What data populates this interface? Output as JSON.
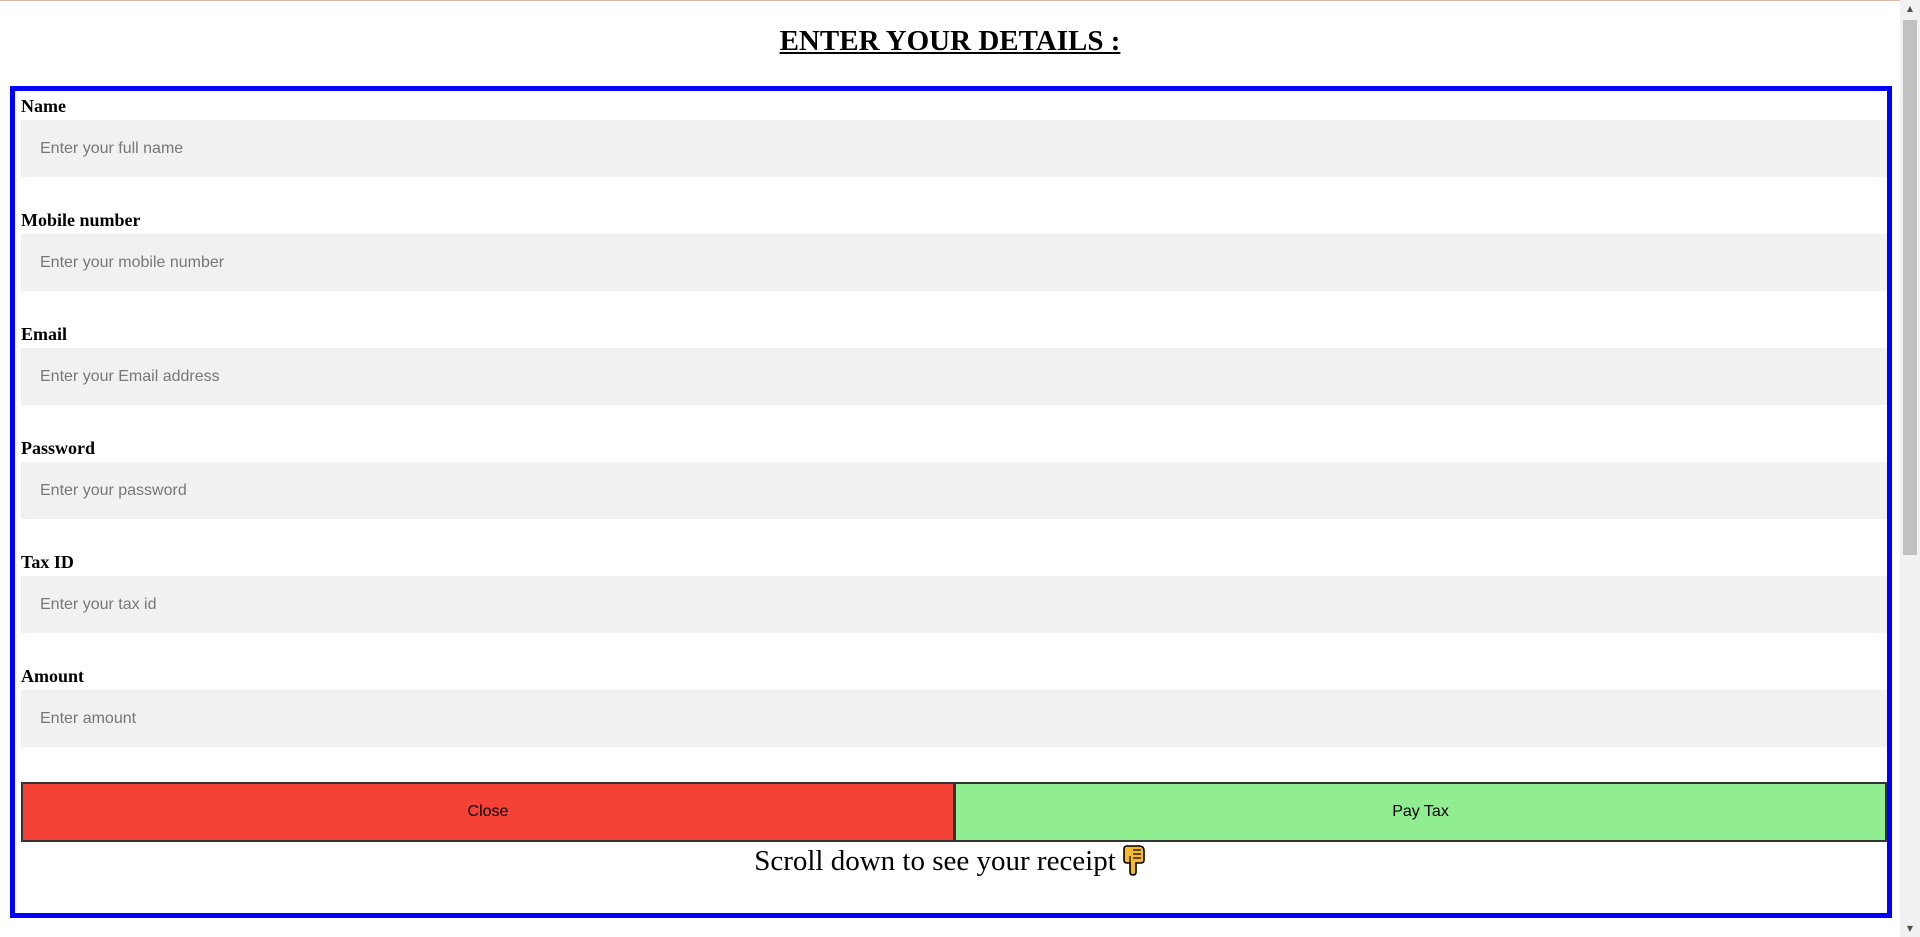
{
  "page": {
    "title": "ENTER YOUR DETAILS :"
  },
  "form": {
    "fields": [
      {
        "label": "Name",
        "placeholder": "Enter your full name",
        "value": ""
      },
      {
        "label": "Mobile number",
        "placeholder": "Enter your mobile number",
        "value": ""
      },
      {
        "label": "Email",
        "placeholder": "Enter your Email address",
        "value": ""
      },
      {
        "label": "Password",
        "placeholder": "Enter your password",
        "value": ""
      },
      {
        "label": "Tax ID",
        "placeholder": "Enter your tax id",
        "value": ""
      },
      {
        "label": "Amount",
        "placeholder": "Enter amount",
        "value": ""
      }
    ],
    "close_label": "Close",
    "pay_label": "Pay Tax",
    "scroll_note": "Scroll down to see your receipt",
    "scroll_note_icon": "pointing-down-hand-icon"
  },
  "colors": {
    "form_border": "#0000ff",
    "close_button": "#f44336",
    "pay_button": "#90ee90",
    "input_background": "#f1f1f1"
  }
}
